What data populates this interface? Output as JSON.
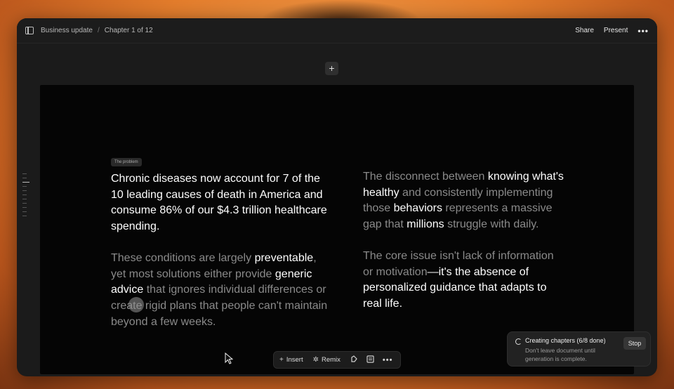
{
  "topbar": {
    "breadcrumb": [
      "Business update",
      "Chapter 1 of 12"
    ],
    "share_label": "Share",
    "present_label": "Present",
    "more_label": "•••"
  },
  "add_label": "+",
  "slide": {
    "tag": "The problem",
    "left": {
      "p1": "Chronic diseases now account for 7 of the 10 leading causes of death in America and consume 86% of our $4.3 trillion healthcare spending.",
      "p2": [
        {
          "t": "These conditions are largely ",
          "s": "d"
        },
        {
          "t": "preventable",
          "s": "w"
        },
        {
          "t": ", yet most solutions either provide ",
          "s": "d"
        },
        {
          "t": "generic advice",
          "s": "w"
        },
        {
          "t": " that ignores individual differences or create rigid plans that people can't maintain beyond a few weeks.",
          "s": "d"
        }
      ]
    },
    "right": {
      "p1": [
        {
          "t": "The disconnect between ",
          "s": "d"
        },
        {
          "t": "knowing what's healthy",
          "s": "w"
        },
        {
          "t": " and consistently implementing those ",
          "s": "d"
        },
        {
          "t": "behaviors",
          "s": "w"
        },
        {
          "t": " represents a massive gap that ",
          "s": "d"
        },
        {
          "t": "millions",
          "s": "w"
        },
        {
          "t": " struggle with daily.",
          "s": "d"
        }
      ],
      "p2": [
        {
          "t": "The core issue isn't lack of information or motivation",
          "s": "d"
        },
        {
          "t": "—it's the absence of personalized guidance that adapts to real life.",
          "s": "w"
        }
      ]
    }
  },
  "toolbar": {
    "insert_label": "Insert",
    "remix_label": "Remix",
    "insert_icon": "+",
    "remix_icon": "✲"
  },
  "toast": {
    "title": "Creating chapters (6/8 done)",
    "body": "Don't leave document until generation is complete.",
    "stop_label": "Stop"
  },
  "colors": {
    "text_bright": "#ffffff",
    "text_dim": "#8a8a8a",
    "slide_bg": "#050505",
    "window_bg": "#1b1b1b"
  }
}
